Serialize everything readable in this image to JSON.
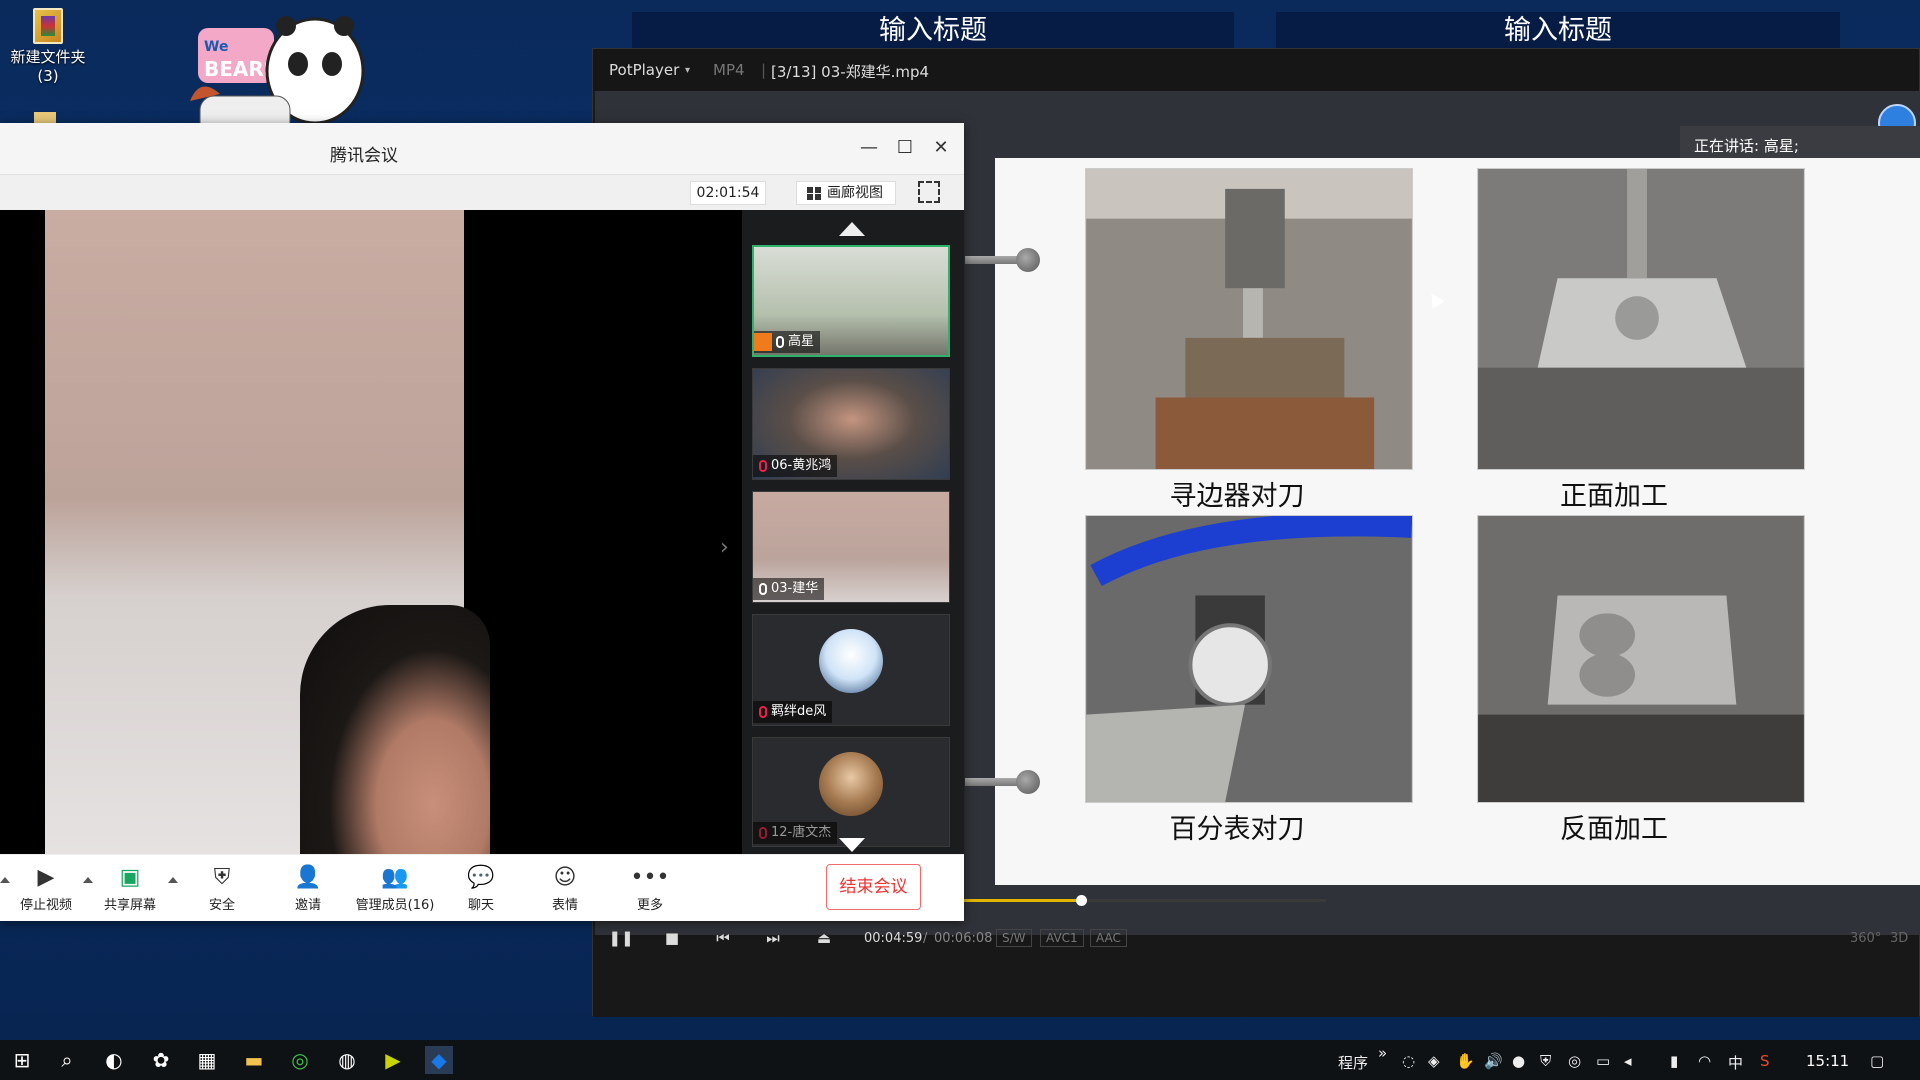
{
  "desktop": {
    "folder_label": "新建文件夹",
    "folder_count": "(3)",
    "slide_titles": [
      "输入标题",
      "输入标题"
    ]
  },
  "potplayer": {
    "app_name": "PotPlayer",
    "format": "MP4",
    "file": "[3/13] 03-郑建华.mp4",
    "current_time": "00:04:59",
    "separator": "/",
    "total_time": "00:06:08",
    "progress": 0.814,
    "tags": [
      "S/W",
      "AVC1",
      "AAC"
    ],
    "right_tags": [
      "360°",
      "3D"
    ],
    "speaking": "正在讲话: 高星;"
  },
  "slide": {
    "captions": [
      "寻边器对刀",
      "正面加工",
      "百分表对刀",
      "反面加工"
    ]
  },
  "meeting": {
    "title": "腾讯会议",
    "timer": "02:01:54",
    "gallery_label": "画廊视图",
    "participants": [
      {
        "name": "高星",
        "muted": false,
        "active": true
      },
      {
        "name": "06-黄兆鸿",
        "muted": true,
        "active": false
      },
      {
        "name": "03-建华",
        "muted": false,
        "active": false
      },
      {
        "name": "羁绊de风",
        "muted": true,
        "active": false
      },
      {
        "name": "12-唐文杰",
        "muted": true,
        "active": false
      }
    ],
    "toolbar": {
      "stop_video": "停止视频",
      "share_screen": "共享屏幕",
      "security": "安全",
      "invite": "邀请",
      "manage_members": "管理成员(16)",
      "chat": "聊天",
      "emoji": "表情",
      "more": "更多",
      "end": "结束会议"
    }
  },
  "taskbar": {
    "programs_label": "程序",
    "overflow": "»",
    "ime": "中",
    "time": "15:11"
  }
}
